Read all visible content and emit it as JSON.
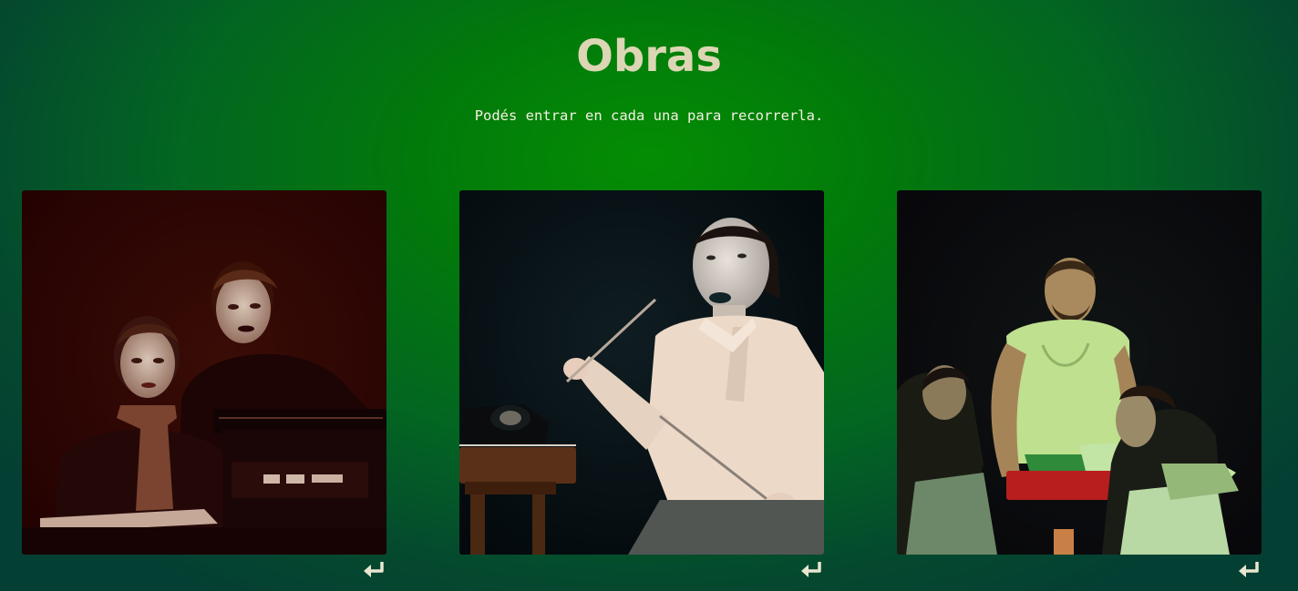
{
  "page": {
    "title": "Obras",
    "subtitle": "Podés entrar en cada una para recorrerla."
  },
  "icons": {
    "enter": "enter-return-icon"
  },
  "colors": {
    "background_center": "#048d04",
    "background_edge": "#043f33",
    "title": "#dcd6b4",
    "subtitle": "#f4f1e2",
    "icon": "#e9e6d0"
  }
}
